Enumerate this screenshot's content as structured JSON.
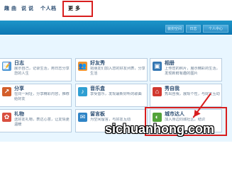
{
  "nav": {
    "items": [
      {
        "label": "趣 曲"
      },
      {
        "label": "说 说"
      },
      {
        "label": "个人档"
      },
      {
        "label": "更 多"
      }
    ]
  },
  "banner": {
    "buttons": [
      {
        "label": "装扮空间"
      },
      {
        "label": "日志"
      },
      {
        "label": "个人中心"
      }
    ]
  },
  "apps": [
    {
      "title": "日志",
      "desc": "展示自己，记录生活，用日志分享您的人生",
      "icon_name": "journal-icon",
      "icon_glyph": "📝",
      "color": "#4e96d4"
    },
    {
      "title": "好友秀",
      "desc": "把朋友们加入您的好友列表，分享生活",
      "icon_name": "friends-icon",
      "icon_glyph": "👥",
      "color": "#f1932d"
    },
    {
      "title": "相册",
      "desc": "上传您的照片，展示精彩的生活，发现新鲜有趣的图片",
      "icon_name": "photo-album-icon",
      "icon_glyph": "▣",
      "color": "#3477b3"
    },
    {
      "title": "分享",
      "desc": "在同一网址，分享精彩内容，推荐给好友",
      "icon_name": "share-icon",
      "icon_glyph": "↗",
      "color": "#d35e2a"
    },
    {
      "title": "音乐盒",
      "desc": "享受音乐，发现最新好听的歌曲",
      "icon_name": "music-box-icon",
      "icon_glyph": "♪",
      "color": "#2f9fd2"
    },
    {
      "title": "秀自我",
      "desc": "秀出自我，展现个性，与好友互动",
      "icon_name": "profile-icon",
      "icon_glyph": "⌂",
      "color": "#d1382f"
    },
    {
      "title": "礼物",
      "desc": "送好友礼物，表达心意，让友情更温暖",
      "icon_name": "gift-icon",
      "icon_glyph": "✿",
      "color": "#d94f3f"
    },
    {
      "title": "留言板",
      "desc": "为空间留言，与好友互动",
      "icon_name": "message-board-icon",
      "icon_glyph": "✉",
      "color": "#2f84c6"
    },
    {
      "title": "城市达人",
      "desc": "加入身边同城社区，结识",
      "icon_name": "city-icon",
      "icon_glyph": "◐",
      "color": "#52a33a"
    }
  ],
  "watermark": {
    "text": "sichuanhong.com"
  },
  "colors": {
    "accent": "#d81e1e",
    "banner": "#138bc4",
    "content_bg": "#e8f6ff"
  }
}
